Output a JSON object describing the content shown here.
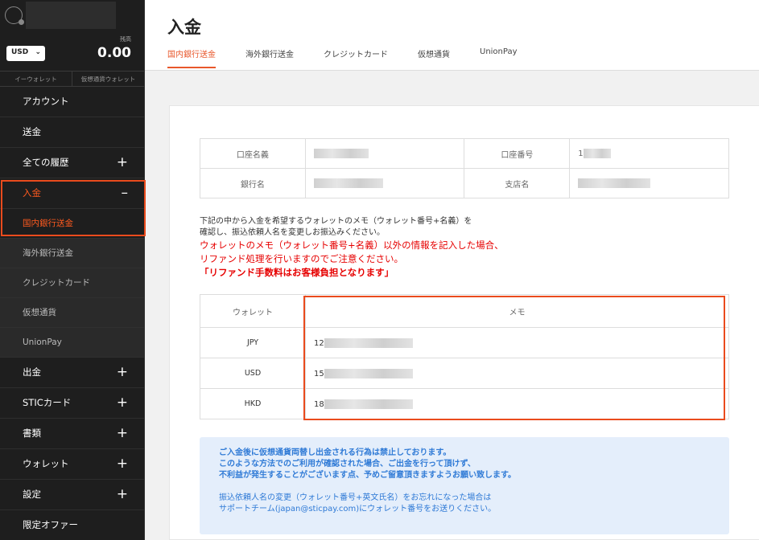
{
  "sidebar": {
    "balance_label": "残高",
    "balance_value": "0.00",
    "currency": "USD",
    "wallet_tabs": [
      "イーウォレット",
      "仮想通貨ウォレット"
    ],
    "items": [
      {
        "label": "アカウント"
      },
      {
        "label": "送金"
      },
      {
        "label": "全ての履歴",
        "expander": "+"
      },
      {
        "label": "入金",
        "expander": "–"
      },
      {
        "label": "国内銀行送金"
      },
      {
        "label": "海外銀行送金"
      },
      {
        "label": "クレジットカード"
      },
      {
        "label": "仮想通貨"
      },
      {
        "label": "UnionPay"
      },
      {
        "label": "出金",
        "expander": "+"
      },
      {
        "label": "STICカード",
        "expander": "+"
      },
      {
        "label": "書類",
        "expander": "+"
      },
      {
        "label": "ウォレット",
        "expander": "+"
      },
      {
        "label": "設定",
        "expander": "+"
      },
      {
        "label": "限定オファー"
      }
    ]
  },
  "header": {
    "title": "入金",
    "tabs": [
      "国内銀行送金",
      "海外銀行送金",
      "クレジットカード",
      "仮想通貨",
      "UnionPay"
    ]
  },
  "bank_info": {
    "account_name_label": "口座名義",
    "account_number_label": "口座番号",
    "bank_name_label": "銀行名",
    "branch_label": "支店名",
    "account_number_prefix": "1"
  },
  "notice": {
    "line1": "下記の中から入金を希望するウォレットのメモ（ウォレット番号+名義）を",
    "line2": "確認し、振込依頼人名を変更しお振込みください。",
    "warn1": "ウォレットのメモ（ウォレット番号+名義）以外の情報を記入した場合、",
    "warn2": "リファンド処理を行いますのでご注意ください。",
    "warn3": "「リファンド手数料はお客様負担となります」"
  },
  "wallet_table": {
    "header_wallet": "ウォレット",
    "header_memo": "メモ",
    "rows": [
      {
        "currency": "JPY",
        "memo_prefix": "12"
      },
      {
        "currency": "USD",
        "memo_prefix": "15"
      },
      {
        "currency": "HKD",
        "memo_prefix": "18"
      }
    ]
  },
  "alert": {
    "l1": "ご入金後に仮想通貨両替し出金される行為は禁止しております。",
    "l2": "このような方法でのご利用が確認された場合、ご出金を行って頂けず、",
    "l3": "不利益が発生することがございます点、予めご留意頂きますようお願い致します。",
    "l4": "振込依頼人名の変更（ウォレット番号+英文氏名）をお忘れになった場合は",
    "l5": "サポートチーム(japan@sticpay.com)にウォレット番号をお送りください。"
  },
  "colors": {
    "accent": "#e8572b",
    "sidebar_bg": "#1e1e1e",
    "warning_red": "#e60000",
    "alert_bg": "#e4eefb",
    "alert_text": "#2f7ad6"
  }
}
